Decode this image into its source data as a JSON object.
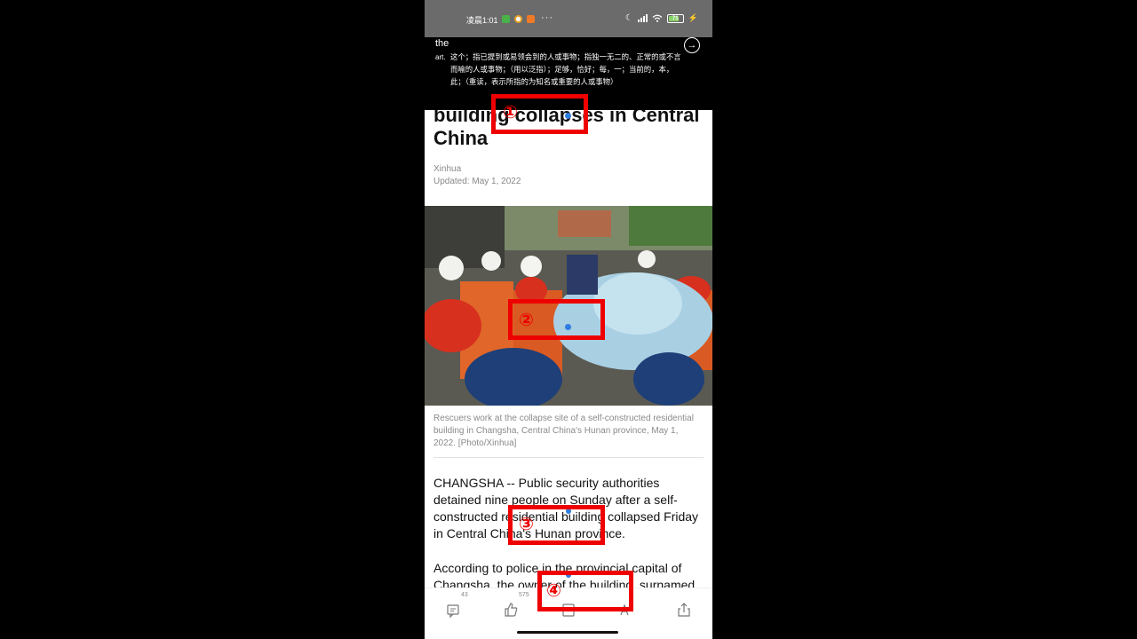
{
  "status_bar": {
    "time": "凌晨1:01",
    "dots": "···",
    "battery": "71"
  },
  "dictionary": {
    "word": "the",
    "pos": "art.",
    "definition": "这个；指已提到或易领会到的人或事物；指独一无二的、正常的或不言而喻的人或事物；（用以泛指）；足够，恰好；每，一；当前的，本，此；（重读，表示所指的为知名或重要的人或事物）",
    "icon": "arrow-right-circle-icon"
  },
  "article": {
    "headline": "building collapses in Central China",
    "source": "Xinhua",
    "updated": "Updated: May 1, 2022",
    "caption": "Rescuers work at the collapse site of a self-constructed residential building in Changsha, Central China's Hunan province, May 1, 2022. [Photo/Xinhua]",
    "paragraphs": [
      "CHANGSHA -- Public security authorities detained nine people on Sunday after a self-constructed residential building collapsed Friday in Central China's Hunan province.",
      "According to police in the provincial capital of Changsha, the owner of the building, surnamed"
    ]
  },
  "bottom_bar": {
    "comment_count": "43",
    "like_count": "575",
    "icons": [
      "comment-icon",
      "thumbs-up-icon",
      "favorite-icon",
      "font-size-icon",
      "share-icon"
    ]
  },
  "annotations": {
    "labels": [
      "①",
      "②",
      "③",
      "④"
    ],
    "color": "#e00000"
  },
  "colors": {
    "status_bar_bg": "#6b6b6b",
    "popup_bg": "#000000",
    "selection_handle": "#2e7de0"
  }
}
